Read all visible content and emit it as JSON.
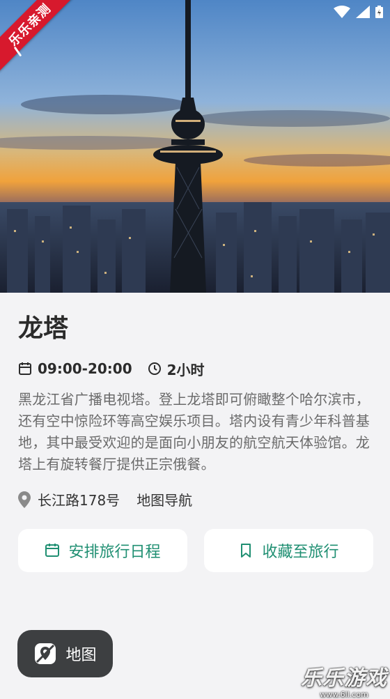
{
  "hero": {
    "ribbon_text": "乐乐亲测"
  },
  "attraction": {
    "title": "龙塔",
    "hours": "09:00-20:00",
    "duration": "2小时",
    "description": "黑龙江省广播电视塔。登上龙塔即可俯瞰整个哈尔滨市，还有空中惊险环等高空娱乐项目。塔内设有青少年科普基地，其中最受欢迎的是面向小朋友的航空航天体验馆。龙塔上有旋转餐厅提供正宗俄餐。",
    "address": "长江路178号",
    "nav_link": "地图导航"
  },
  "actions": {
    "schedule_label": "安排旅行日程",
    "favorite_label": "收藏至旅行"
  },
  "map_button": {
    "label": "地图"
  },
  "watermark": {
    "main": "乐乐游戏",
    "sub": "www.6ll.com"
  },
  "colors": {
    "accent": "#1f8f72",
    "ribbon": "#d7192d",
    "fab": "#3d3f41"
  }
}
